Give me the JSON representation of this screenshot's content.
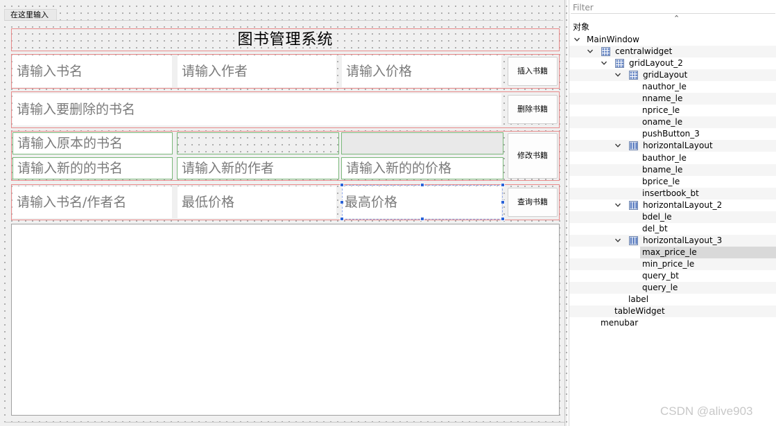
{
  "menubar": {
    "placeholder": "在这里输入"
  },
  "form": {
    "title": "图书管理系统",
    "insert_row": {
      "name_placeholder": "请输入书名",
      "author_placeholder": "请输入作者",
      "price_placeholder": "请输入价格",
      "button": "插入书籍"
    },
    "delete_row": {
      "name_placeholder": "请输入要删除的书名",
      "button": "删除书籍"
    },
    "modify_row": {
      "old_name_placeholder": "请输入原本的书名",
      "new_name_placeholder": "请输入新的的书名",
      "new_author_placeholder": "请输入新的作者",
      "new_price_placeholder": "请输入新的的价格",
      "button": "修改书籍"
    },
    "query_row": {
      "query_placeholder": "请输入书名/作者名",
      "min_price_placeholder": "最低价格",
      "max_price_placeholder": "最高价格",
      "button": "查询书籍"
    }
  },
  "inspector": {
    "filter_placeholder": "Filter",
    "column_header": "对象",
    "tree": [
      {
        "label": "MainWindow",
        "depth": 0,
        "expand": true,
        "icon": ""
      },
      {
        "label": "centralwidget",
        "depth": 1,
        "expand": true,
        "icon": "grid-layout-icon"
      },
      {
        "label": "gridLayout_2",
        "depth": 2,
        "expand": true,
        "icon": "grid-layout-icon"
      },
      {
        "label": "gridLayout",
        "depth": 3,
        "expand": true,
        "icon": "grid-layout-icon"
      },
      {
        "label": "nauthor_le",
        "depth": 4,
        "expand": false,
        "icon": ""
      },
      {
        "label": "nname_le",
        "depth": 4,
        "expand": false,
        "icon": ""
      },
      {
        "label": "nprice_le",
        "depth": 4,
        "expand": false,
        "icon": ""
      },
      {
        "label": "oname_le",
        "depth": 4,
        "expand": false,
        "icon": ""
      },
      {
        "label": "pushButton_3",
        "depth": 4,
        "expand": false,
        "icon": ""
      },
      {
        "label": "horizontalLayout",
        "depth": 3,
        "expand": true,
        "icon": "horizontal-layout-icon"
      },
      {
        "label": "bauthor_le",
        "depth": 4,
        "expand": false,
        "icon": ""
      },
      {
        "label": "bname_le",
        "depth": 4,
        "expand": false,
        "icon": ""
      },
      {
        "label": "bprice_le",
        "depth": 4,
        "expand": false,
        "icon": ""
      },
      {
        "label": "insertbook_bt",
        "depth": 4,
        "expand": false,
        "icon": ""
      },
      {
        "label": "horizontalLayout_2",
        "depth": 3,
        "expand": true,
        "icon": "horizontal-layout-icon"
      },
      {
        "label": "bdel_le",
        "depth": 4,
        "expand": false,
        "icon": ""
      },
      {
        "label": "del_bt",
        "depth": 4,
        "expand": false,
        "icon": ""
      },
      {
        "label": "horizontalLayout_3",
        "depth": 3,
        "expand": true,
        "icon": "horizontal-layout-icon"
      },
      {
        "label": "max_price_le",
        "depth": 4,
        "expand": false,
        "icon": "",
        "selected": true
      },
      {
        "label": "min_price_le",
        "depth": 4,
        "expand": false,
        "icon": ""
      },
      {
        "label": "query_bt",
        "depth": 4,
        "expand": false,
        "icon": ""
      },
      {
        "label": "query_le",
        "depth": 4,
        "expand": false,
        "icon": ""
      },
      {
        "label": "label",
        "depth": 3,
        "expand": false,
        "icon": ""
      },
      {
        "label": "tableWidget",
        "depth": 2,
        "expand": false,
        "icon": ""
      },
      {
        "label": "menubar",
        "depth": 1,
        "expand": false,
        "icon": ""
      }
    ]
  },
  "watermark": "CSDN @alive903"
}
